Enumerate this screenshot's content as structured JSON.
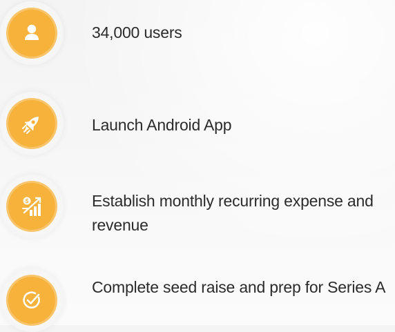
{
  "colors": {
    "accent": "#f7b23b",
    "text": "#2b2b2b"
  },
  "milestones": [
    {
      "text": "34,000 users",
      "icon": "user-icon"
    },
    {
      "text": "Launch Android App",
      "icon": "rocket-icon"
    },
    {
      "text": "Establish monthly recurring expense and revenue",
      "icon": "revenue-growth-icon"
    },
    {
      "text": "Complete seed raise and prep for Series A",
      "icon": "check-circle-icon"
    }
  ]
}
